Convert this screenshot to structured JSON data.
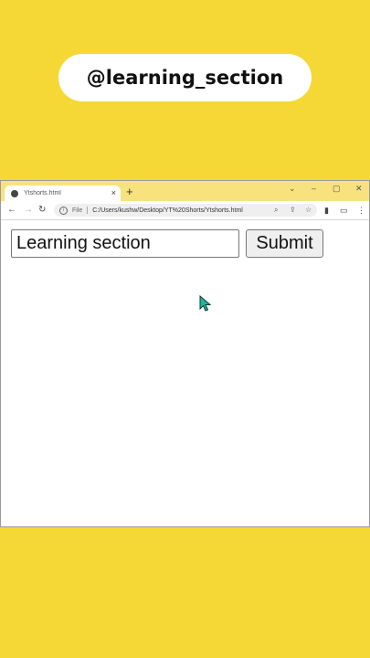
{
  "overlay": {
    "banner_text": "@learning_section"
  },
  "browser": {
    "tab": {
      "title": "Ytshorts.html",
      "close": "×"
    },
    "new_tab": "+",
    "window_controls": {
      "chevron": "⌄",
      "minimize": "–",
      "maximize": "▢",
      "close": "✕"
    },
    "address": {
      "scheme_label": "File",
      "url": "C:/Users/kushw/Desktop/YT%20Shorts/Ytshorts.html"
    }
  },
  "page": {
    "input": {
      "value": "Learning section"
    },
    "submit_label": "Submit"
  },
  "colors": {
    "background": "#f5d835",
    "titlebar": "#f7e27e",
    "cursor": "#1fb5a0"
  }
}
